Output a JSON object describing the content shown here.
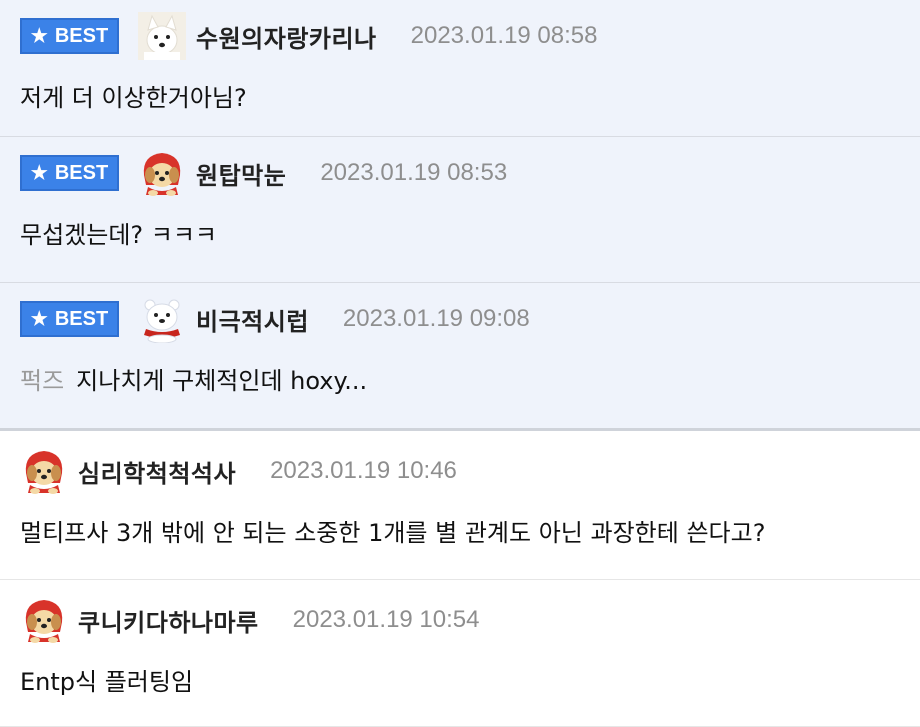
{
  "best_badge_label": "BEST",
  "comments": [
    {
      "best": true,
      "nickname": "수원의자랑카리나",
      "date": "2023.01.19 08:58",
      "text": "저게 더 이상한거아님?",
      "tag": "",
      "avatar": "white-dog-avatar"
    },
    {
      "best": true,
      "nickname": "원탑막눈",
      "date": "2023.01.19 08:53",
      "text": "무섭겠는데? ㅋㅋㅋ",
      "tag": "",
      "avatar": "puppy-red-hood-avatar"
    },
    {
      "best": true,
      "nickname": "비극적시럽",
      "date": "2023.01.19 09:08",
      "text": "지나치게 구체적인데 hoxy...",
      "tag": "퍽즈",
      "avatar": "polar-bear-red-scarf-avatar"
    },
    {
      "best": false,
      "nickname": "심리학척척석사",
      "date": "2023.01.19 10:46",
      "text": "멀티프사 3개 밖에 안 되는 소중한 1개를 별 관계도 아닌 과장한테 쓴다고?",
      "tag": "",
      "avatar": "puppy-red-hood-avatar"
    },
    {
      "best": false,
      "nickname": "쿠니키다하나마루",
      "date": "2023.01.19 10:54",
      "text": "Entp식 플러팅임",
      "tag": "",
      "avatar": "puppy-red-hood-avatar"
    }
  ],
  "colors": {
    "best_bg": "#eff3fb",
    "badge": "#3b82e8",
    "date": "#8e8e8e",
    "tag": "#9a9a9a"
  }
}
